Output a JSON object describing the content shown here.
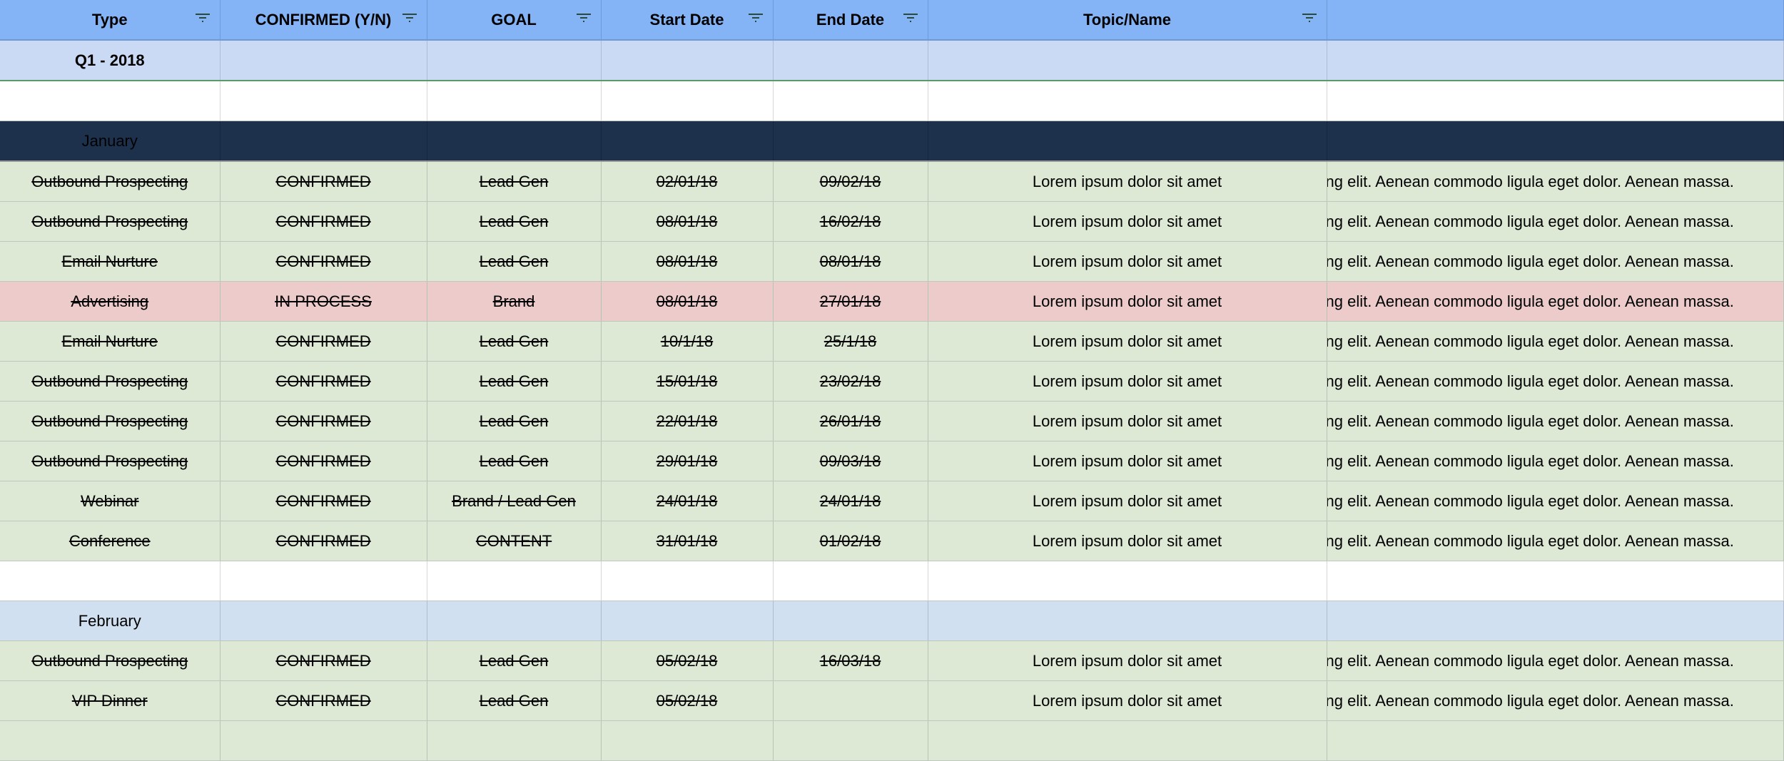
{
  "headers": [
    "Type",
    "CONFIRMED (Y/N)",
    "GOAL",
    "Start Date",
    "End Date",
    "Topic/Name",
    ""
  ],
  "quarter": "Q1 - 2018",
  "months": {
    "january": "January",
    "february": "February"
  },
  "colors": {
    "header": "#84b4f6",
    "quarter": "#cbdaf4",
    "january": "#1d314d",
    "february": "#d0e0f0",
    "confirmed_row": "#dde8d5",
    "in_process_row": "#edcbcb"
  },
  "january_rows": [
    {
      "type": "Outbound Prospecting",
      "confirmed": "CONFIRMED",
      "goal": "Lead Gen",
      "start": "02/01/18",
      "end": "09/02/18",
      "topic": "Lorem ipsum dolor sit amet",
      "desc": "ng elit. Aenean commodo ligula eget dolor. Aenean massa.",
      "status": "confirmed"
    },
    {
      "type": "Outbound Prospecting",
      "confirmed": "CONFIRMED",
      "goal": "Lead Gen",
      "start": "08/01/18",
      "end": "16/02/18",
      "topic": "Lorem ipsum dolor sit amet",
      "desc": "ng elit. Aenean commodo ligula eget dolor. Aenean massa.",
      "status": "confirmed"
    },
    {
      "type": "Email Nurture",
      "confirmed": "CONFIRMED",
      "goal": "Lead Gen",
      "start": "08/01/18",
      "end": "08/01/18",
      "topic": "Lorem ipsum dolor sit amet",
      "desc": "ng elit. Aenean commodo ligula eget dolor. Aenean massa.",
      "status": "confirmed"
    },
    {
      "type": "Advertising",
      "confirmed": "IN PROCESS",
      "goal": "Brand",
      "start": "08/01/18",
      "end": "27/01/18",
      "topic": "Lorem ipsum dolor sit amet",
      "desc": "ng elit. Aenean commodo ligula eget dolor. Aenean massa.",
      "status": "in-process"
    },
    {
      "type": "Email Nurture",
      "confirmed": "CONFIRMED",
      "goal": "Lead Gen",
      "start": "10/1/18",
      "end": "25/1/18",
      "topic": "Lorem ipsum dolor sit amet",
      "desc": "ng elit. Aenean commodo ligula eget dolor. Aenean massa.",
      "status": "confirmed"
    },
    {
      "type": "Outbound Prospecting",
      "confirmed": "CONFIRMED",
      "goal": "Lead Gen",
      "start": "15/01/18",
      "end": "23/02/18",
      "topic": "Lorem ipsum dolor sit amet",
      "desc": "ng elit. Aenean commodo ligula eget dolor. Aenean massa.",
      "status": "confirmed"
    },
    {
      "type": "Outbound Prospecting",
      "confirmed": "CONFIRMED",
      "goal": "Lead Gen",
      "start": "22/01/18",
      "end": "26/01/18",
      "topic": "Lorem ipsum dolor sit amet",
      "desc": "ng elit. Aenean commodo ligula eget dolor. Aenean massa.",
      "status": "confirmed"
    },
    {
      "type": "Outbound Prospecting",
      "confirmed": "CONFIRMED",
      "goal": "Lead Gen",
      "start": "29/01/18",
      "end": "09/03/18",
      "topic": "Lorem ipsum dolor sit amet",
      "desc": "ng elit. Aenean commodo ligula eget dolor. Aenean massa.",
      "status": "confirmed"
    },
    {
      "type": "Webinar",
      "confirmed": "CONFIRMED",
      "goal": "Brand / Lead Gen",
      "start": "24/01/18",
      "end": "24/01/18",
      "topic": "Lorem ipsum dolor sit amet",
      "desc": "ng elit. Aenean commodo ligula eget dolor. Aenean massa.",
      "status": "confirmed"
    },
    {
      "type": "Conference",
      "confirmed": "CONFIRMED",
      "goal": "CONTENT",
      "start": "31/01/18",
      "end": "01/02/18",
      "topic": "Lorem ipsum dolor sit amet",
      "desc": "ng elit. Aenean commodo ligula eget dolor. Aenean massa.",
      "status": "confirmed"
    }
  ],
  "february_rows": [
    {
      "type": "Outbound Prospecting",
      "confirmed": "CONFIRMED",
      "goal": "Lead Gen",
      "start": "05/02/18",
      "end": "16/03/18",
      "topic": "Lorem ipsum dolor sit amet",
      "desc": "ng elit. Aenean commodo ligula eget dolor. Aenean massa.",
      "status": "confirmed"
    },
    {
      "type": "VIP Dinner",
      "confirmed": "CONFIRMED",
      "goal": "Lead Gen",
      "start": "05/02/18",
      "end": "",
      "topic": "Lorem ipsum dolor sit amet",
      "desc": "ng elit. Aenean commodo ligula eget dolor. Aenean massa.",
      "status": "confirmed"
    }
  ]
}
